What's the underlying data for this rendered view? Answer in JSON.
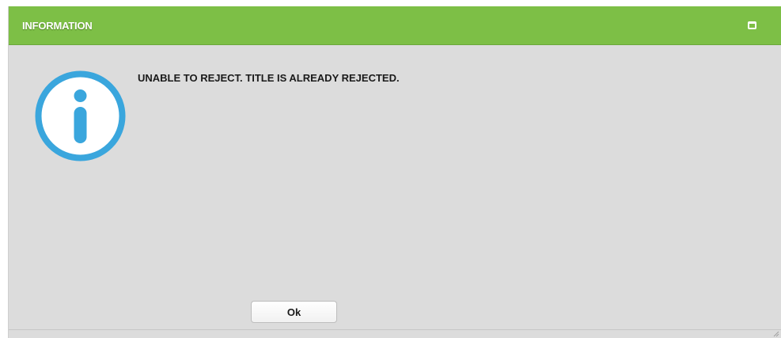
{
  "dialog": {
    "title": "INFORMATION",
    "message": "UNABLE TO REJECT. TITLE IS ALREADY REJECTED.",
    "ok_label": "Ok",
    "icon": "info-icon",
    "maximize_icon": "maximize-icon",
    "resize_icon": "resize-grip-icon"
  },
  "colors": {
    "titlebar": "#7dbf46",
    "body": "#dcdcdc",
    "info_icon": "#3aa6dd",
    "title_text": "#ffffff"
  }
}
